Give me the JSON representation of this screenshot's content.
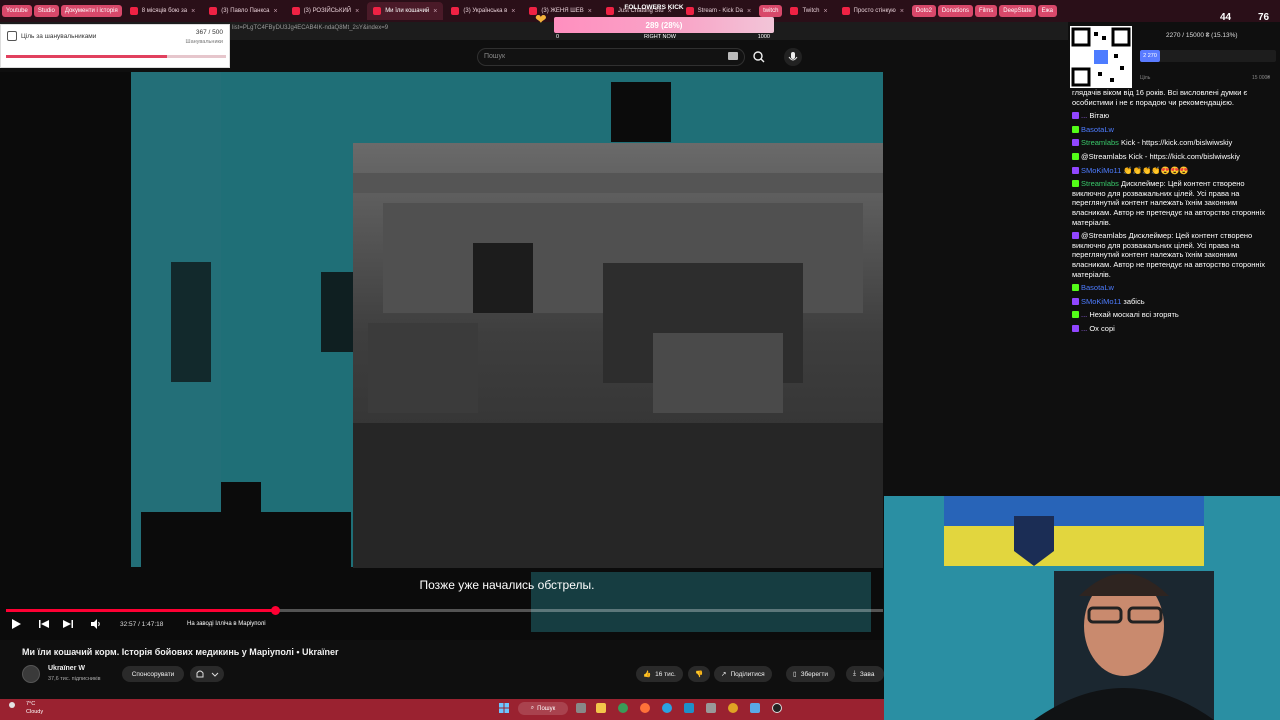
{
  "browser": {
    "tabs": [
      {
        "label": "Youtube",
        "style": "badge"
      },
      {
        "label": "Studio",
        "style": "badge"
      },
      {
        "label": "Документи і історія",
        "style": "badge"
      },
      {
        "label": "8 місяців бою за",
        "style": "tab"
      },
      {
        "label": "(3) Павло Панкса",
        "style": "tab"
      },
      {
        "label": "(3) РОЗІЙСЬКИЙ",
        "style": "tab"
      },
      {
        "label": "Ми їли кошачий",
        "style": "active"
      },
      {
        "label": "(3) Українська в",
        "style": "tab"
      },
      {
        "label": "(3) ЖЕНЯ ШЕВ",
        "style": "tab"
      },
      {
        "label": "Just Chatting Stu",
        "style": "tab"
      },
      {
        "label": "Stream - Kick Da",
        "style": "tab"
      },
      {
        "label": "twitch",
        "style": "badge"
      },
      {
        "label": "Twitch",
        "style": "tab"
      },
      {
        "label": "Просто стінкую",
        "style": "tab"
      },
      {
        "label": "Doto2",
        "style": "badge"
      },
      {
        "label": "Donations",
        "style": "badge"
      },
      {
        "label": "Films",
        "style": "badge"
      },
      {
        "label": "DeepState",
        "style": "badge"
      },
      {
        "label": "Ежа",
        "style": "badge"
      }
    ],
    "url": "list=PLgTC4FByDU3Jg4ECAB4IK-ndaQ8Mt_2sY&index=9"
  },
  "goal": {
    "title": "Ціль за шанувальниками",
    "count": "367 / 500",
    "subtitle": "Шанувальники",
    "fraction": 0.734
  },
  "followers": {
    "title": "FOLLOWERS KICK",
    "value": "289 (28%)",
    "min": "0",
    "mid": "RIGHT NOW",
    "max": "1000",
    "fraction": 0.289
  },
  "youtube": {
    "search_placeholder": "Пошук",
    "subtitle": "Позже уже начались обстрелы.",
    "time": "32:57 / 1:47:18",
    "chapter": "На заводі Ілліча в Маріуполі",
    "progress_fraction": 0.307,
    "title": "Ми їли кошачий корм. Історія бойових медикинь у Маріуполі • Ukraїner",
    "channel": "Ukraїner W",
    "subscribers": "37,6 тис. підписників",
    "sponsor_label": "Спонсорувати",
    "likes": "16 тис.",
    "share_label": "Поділитися",
    "save_label": "Зберегти",
    "more_label": "Завa"
  },
  "stream": {
    "viewers_twitch": "44",
    "viewers_kick": "76",
    "donation_label": "2270 / 15000 ₴ (15.13%)",
    "donation_amount": "2 270",
    "donation_min": "Ціль",
    "donation_max": "15 000₴",
    "donation_fraction": 0.151
  },
  "chat": [
    {
      "name": "",
      "text": "глядачів віком від 16 років. Всі висловлені думки є особистими і не є порадою чи рекомендацією.",
      "color": "#ffffff"
    },
    {
      "name": "...",
      "text": "Вітаю",
      "color": "#a26cff"
    },
    {
      "name": "BasotaLw",
      "text": "",
      "color": "#4d7cff"
    },
    {
      "name": "Streamlabs",
      "text": "Kick - https://kick.com/bislwiwskiy",
      "color": "#39c86a"
    },
    {
      "name": "@Streamlabs",
      "text": "Kick - https://kick.com/bislwiwskiy",
      "color": "#ffffff"
    },
    {
      "name": "SMoKiMo11",
      "text": "👏👏👏👏😍😍😍",
      "color": "#4d7cff"
    },
    {
      "name": "Streamlabs",
      "text": "Дисклеймер: Цей контент створено виключно для розважальних цілей. Усі права на переглянутий контент належать їхнім законним власникам. Автор не претендує на авторство сторонніх матеріалів.",
      "color": "#39c86a"
    },
    {
      "name": "@Streamlabs",
      "text": "Дисклеймер: Цей контент створено виключно для розважальних цілей. Усі права на переглянутий контент належать їхнім законним власникам. Автор не претендує на авторство сторонніх матеріалів.",
      "color": "#ffffff"
    },
    {
      "name": "BasotaLw",
      "text": "",
      "color": "#4d7cff"
    },
    {
      "name": "SMoKiMo11",
      "text": "забісь",
      "color": "#4d7cff"
    },
    {
      "name": "...",
      "text": "Нехай москалі всі згорять",
      "color": "#a26cff"
    },
    {
      "name": "...",
      "text": "Ох сорі",
      "color": "#a26cff"
    }
  ],
  "taskbar": {
    "temp": "7°C",
    "weather": "Cloudy",
    "search_label": "Пошук"
  }
}
